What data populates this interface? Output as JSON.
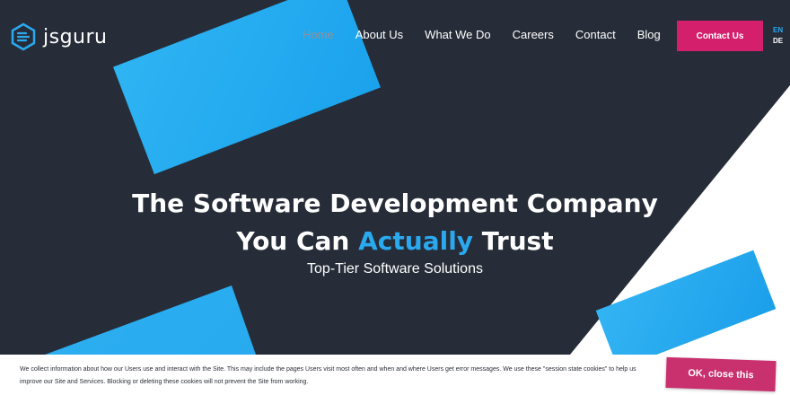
{
  "brand": {
    "name": "jsguru",
    "logo_color": "#2aa9ef"
  },
  "nav": {
    "items": [
      {
        "label": "Home",
        "active": true
      },
      {
        "label": "About Us"
      },
      {
        "label": "What We Do"
      },
      {
        "label": "Careers"
      },
      {
        "label": "Contact"
      },
      {
        "label": "Blog"
      }
    ],
    "cta_label": "Contact Us"
  },
  "language": {
    "current": "EN",
    "other": "DE"
  },
  "hero": {
    "title_line1": "The Software Development Company",
    "title_line2_before": "You Can ",
    "title_line2_accent": "Actually",
    "title_line2_after": " Trust",
    "subtitle": "Top-Tier Software Solutions"
  },
  "cookie": {
    "text": "We collect information about how our Users use and interact with the Site. This may include the pages Users visit most often and when and where Users get error messages. We use these \"session state cookies\" to help us improve our Site and Services. Blocking or deleting these cookies will not prevent the Site from working.",
    "button_label": "OK, close this"
  },
  "colors": {
    "background": "#262c38",
    "accent_blue": "#2aa9ef",
    "cta_pink": "#d31f6c",
    "cookie_button": "#c8306e"
  }
}
